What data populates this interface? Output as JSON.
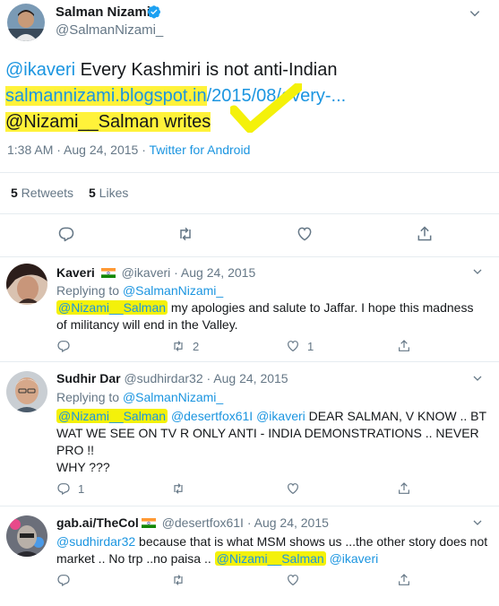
{
  "main_tweet": {
    "author_name": "Salman Nizami",
    "author_handle": "@SalmanNizami_",
    "text_mention": "@ikaveri",
    "text_line1": " Every Kashmiri is not anti-Indian",
    "link_highlighted": "salmannizami.blogspot.in",
    "link_rest": "/2015/08/every-...",
    "line3": "@Nizami__Salman writes",
    "timestamp": "1:38 AM · Aug 24, 2015 · ",
    "client": "Twitter for Android",
    "retweets_count": "5",
    "retweets_label": " Retweets",
    "likes_count": "5",
    "likes_label": " Likes"
  },
  "replies": [
    {
      "name": "Kaveri",
      "handle": "@ikaveri",
      "date": "· Aug 24, 2015",
      "replying_label": "Replying to ",
      "replying_to": "@SalmanNizami_",
      "mention": "@Nizami__Salman",
      "text": " my apologies and salute to Jaffar. I hope this madness of militancy will end in the Valley.",
      "retweets": "2",
      "likes": "1"
    },
    {
      "name": "Sudhir Dar",
      "handle": "@sudhirdar32",
      "date": "· Aug 24, 2015",
      "replying_label": "Replying to ",
      "replying_to": "@SalmanNizami_",
      "mention": "@Nizami__Salman",
      "mention2": "@desertfox61I",
      "mention3": "@ikaveri",
      "text": " DEAR SALMAN, V KNOW .. BT WAT WE SEE ON TV R ONLY ANTI - INDIA DEMONSTRATIONS .. NEVER PRO !!",
      "text2": "WHY ???",
      "replies": "1"
    },
    {
      "name": "gab.ai/TheCol",
      "handle": "@desertfox61I",
      "date": "· Aug 24, 2015",
      "mention": "@sudhirdar32",
      "text": " because that is what MSM shows us ...the other story does not market .. No trp ..no paisa .. ",
      "mention2": "@Nizami__Salman",
      "mention3": "@ikaveri"
    }
  ],
  "colors": {
    "link": "#1b95e0",
    "highlight": "#fff23a",
    "muted": "#657786"
  }
}
